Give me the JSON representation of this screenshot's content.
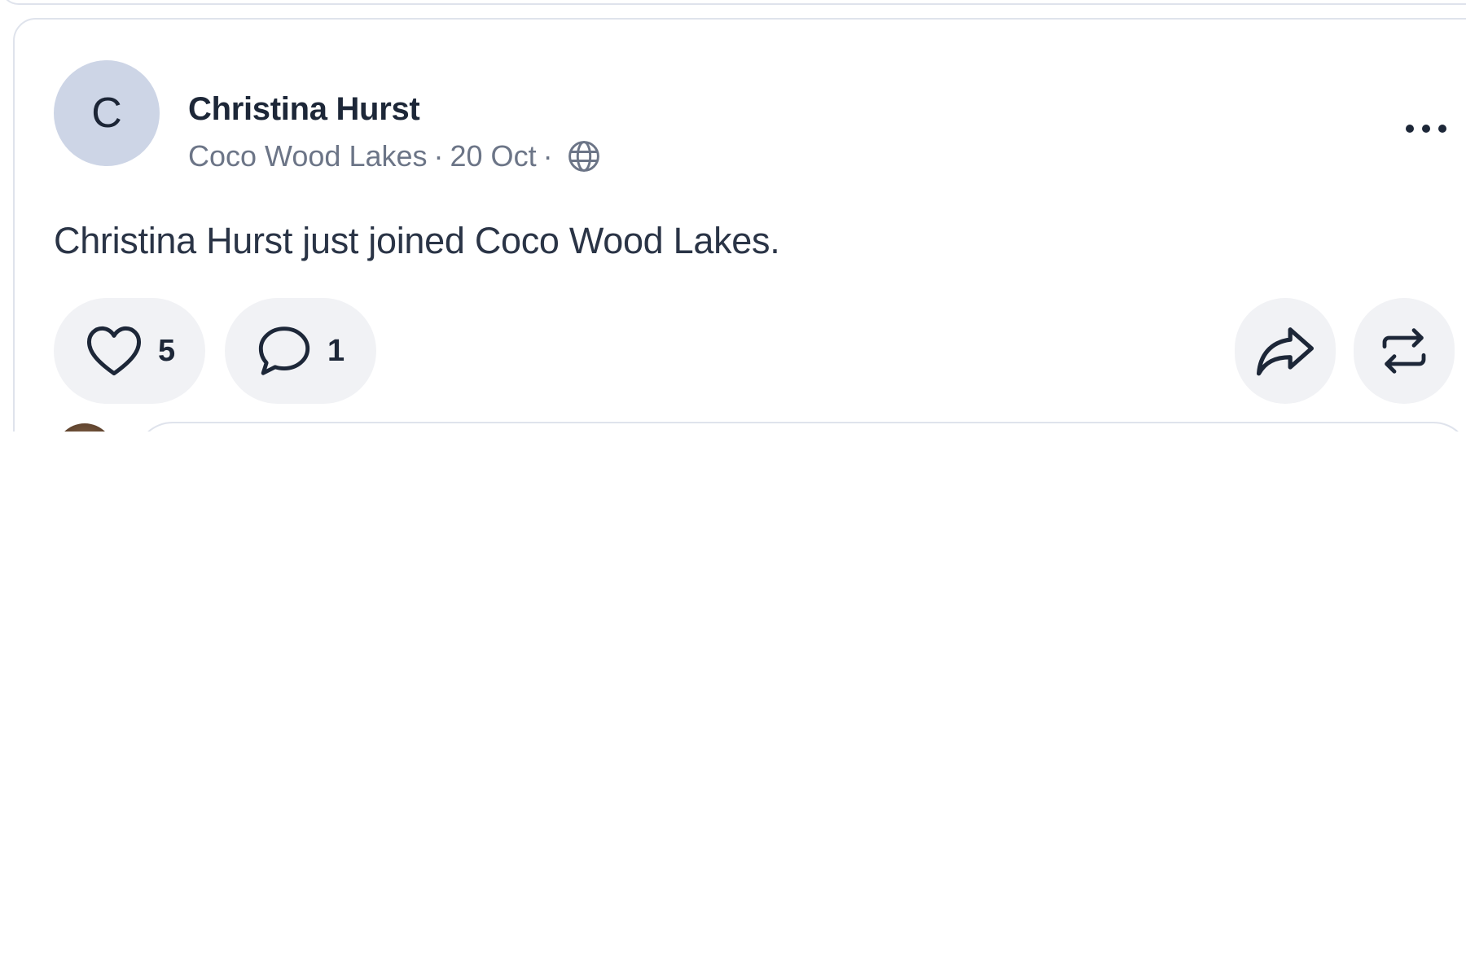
{
  "post": {
    "author": {
      "initial": "C",
      "name": "Christina Hurst"
    },
    "meta": {
      "group": "Coco Wood Lakes",
      "separator": "·",
      "date": "20 Oct",
      "visibility_icon": "globe-icon"
    },
    "body": "Christina Hurst just joined Coco Wood Lakes.",
    "actions": {
      "like_icon": "heart-icon",
      "like_count": "5",
      "comment_icon": "comment-bubble-icon",
      "comment_count": "1",
      "share_icon": "share-arrow-icon",
      "repost_icon": "repost-icon",
      "more_icon": "more-horizontal-icon"
    }
  },
  "colors": {
    "card_border": "#dfe3ec",
    "avatar_bg": "#cdd5e6",
    "pill_bg": "#f1f2f5",
    "text_primary": "#1d2738",
    "text_secondary": "#6c7587"
  }
}
